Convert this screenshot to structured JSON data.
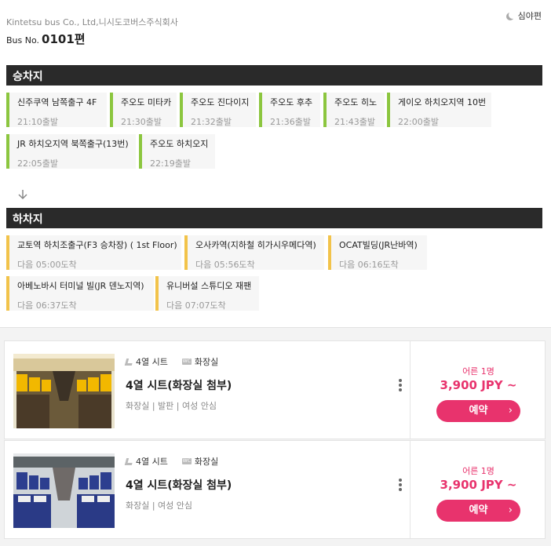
{
  "header": {
    "company": "Kintetsu bus Co., Ltd,니시도코버스주식회사",
    "bus_no_label": "Bus No.",
    "bus_no": "0101편",
    "night_label": "심야편"
  },
  "boarding": {
    "title": "승차지",
    "stops": [
      {
        "name": "신주쿠역 남쪽출구 4F",
        "time": "21:10출발"
      },
      {
        "name": "주오도 미타카",
        "time": "21:30출발"
      },
      {
        "name": "주오도 진다이지",
        "time": "21:32출발"
      },
      {
        "name": "주오도 후추",
        "time": "21:36출발"
      },
      {
        "name": "주오도 히노",
        "time": "21:43출발"
      },
      {
        "name": "게이오 하치오지역 10번",
        "time": "22:00출발"
      },
      {
        "name": "JR 하치오지역 북쪽출구(13번)",
        "time": "22:05출발"
      },
      {
        "name": "주오도 하치오지",
        "time": "22:19출발"
      }
    ]
  },
  "alighting": {
    "title": "하차지",
    "stops": [
      {
        "name": "교토역 하치조출구(F3 승차장) ( 1st Floor)",
        "time": "다음 05:00도착"
      },
      {
        "name": "오사카역(지하철 히가시우메다역)",
        "time": "다음 05:56도착"
      },
      {
        "name": "OCAT빌딩(JR난바역)",
        "time": "다음 06:16도착"
      },
      {
        "name": "아베노바시 터미널 빌(JR 덴노지역)",
        "time": "다음 06:37도착"
      },
      {
        "name": "유니버설 스튜디오 재팬",
        "time": "다음 07:07도착"
      }
    ]
  },
  "seats": [
    {
      "seat_tag": "4열 시트",
      "wc_tag": "화장실",
      "title": "4열 시트(화장실 첨부)",
      "features": "화장실 | 발판 | 여성 안심",
      "price_label": "어른 1명",
      "price": "3,900 JPY ~",
      "button": "예약"
    },
    {
      "seat_tag": "4열 시트",
      "wc_tag": "화장실",
      "title": "4열 시트(화장실 첨부)",
      "features": "화장실 | 여성 안심",
      "price_label": "어른 1명",
      "price": "3,900 JPY ~",
      "button": "예약"
    }
  ],
  "colors": {
    "board_accent": "#8cc63f",
    "alight_accent": "#f2c34a",
    "price_pink": "#e8336d",
    "section_bar": "#2a2a2a"
  },
  "icons": [
    "moon-icon",
    "down-arrow-icon",
    "seat-icon",
    "wc-icon",
    "kebab-icon",
    "chevron-right-icon"
  ]
}
